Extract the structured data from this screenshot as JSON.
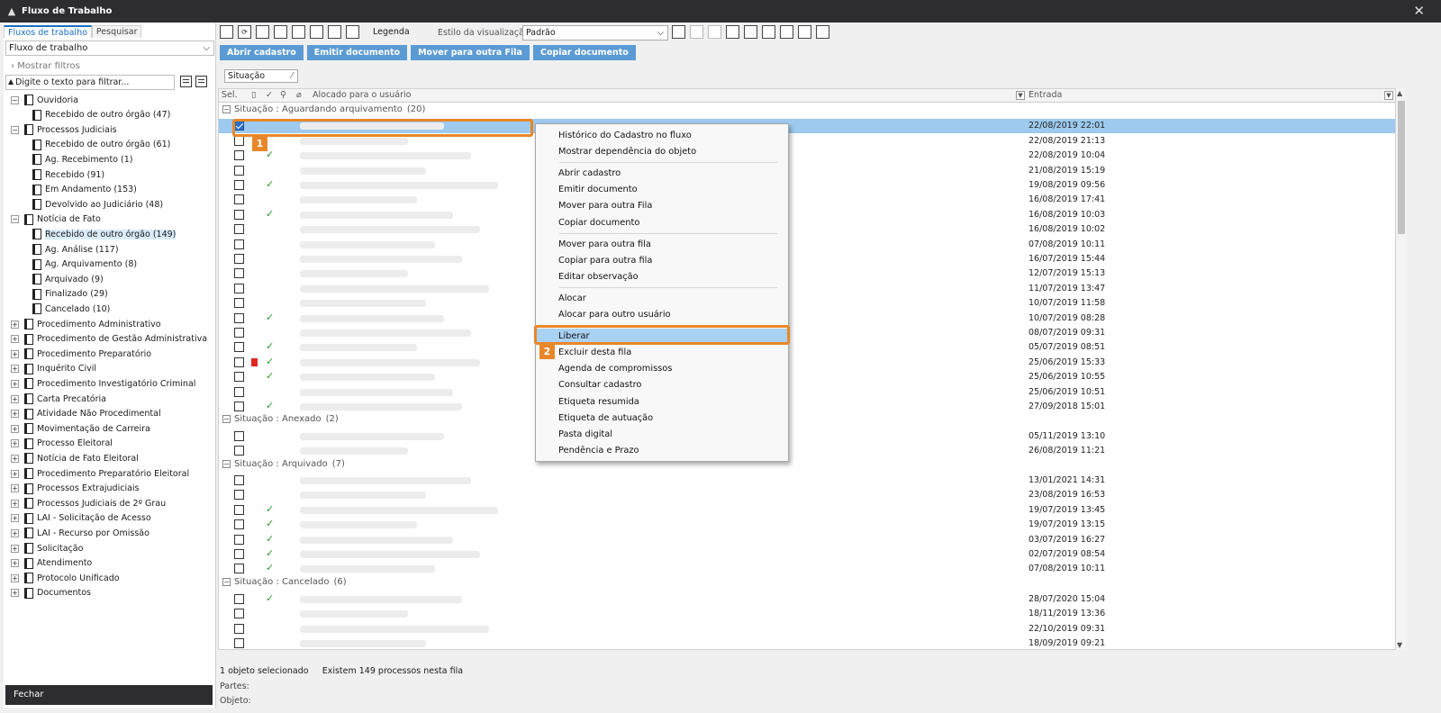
{
  "window": {
    "title": "Fluxo de Trabalho",
    "close": "✕"
  },
  "left": {
    "tabs": [
      "Fluxos de trabalho",
      "Pesquisar"
    ],
    "workflow_select": "Fluxo de trabalho",
    "show_filters": "Mostrar filtros",
    "filter_placeholder": "Digite o texto para filtrar...",
    "tree": [
      {
        "label": "Ouvidoria",
        "level": 0,
        "exp": "−"
      },
      {
        "label": "Recebido de outro órgão (47)",
        "level": 1
      },
      {
        "label": "Processos Judiciais",
        "level": 0,
        "exp": "−"
      },
      {
        "label": "Recebido de outro órgão (61)",
        "level": 1
      },
      {
        "label": "Ag. Recebimento (1)",
        "level": 1
      },
      {
        "label": "Recebido (91)",
        "level": 1
      },
      {
        "label": "Em Andamento (153)",
        "level": 1
      },
      {
        "label": "Devolvido ao Judiciário (48)",
        "level": 1
      },
      {
        "label": "Notícia de Fato",
        "level": 0,
        "exp": "−"
      },
      {
        "label": "Recebido de outro órgão (149)",
        "level": 1,
        "selected": true
      },
      {
        "label": "Ag. Análise (117)",
        "level": 1
      },
      {
        "label": "Ag. Arquivamento (8)",
        "level": 1
      },
      {
        "label": "Arquivado (9)",
        "level": 1
      },
      {
        "label": "Finalizado (29)",
        "level": 1
      },
      {
        "label": "Cancelado (10)",
        "level": 1
      },
      {
        "label": "Procedimento Administrativo",
        "level": 0,
        "exp": "+"
      },
      {
        "label": "Procedimento de Gestão Administrativa",
        "level": 0,
        "exp": "+"
      },
      {
        "label": "Procedimento Preparatório",
        "level": 0,
        "exp": "+"
      },
      {
        "label": "Inquérito Civil",
        "level": 0,
        "exp": "+"
      },
      {
        "label": "Procedimento Investigatório Criminal",
        "level": 0,
        "exp": "+"
      },
      {
        "label": "Carta Precatória",
        "level": 0,
        "exp": "+"
      },
      {
        "label": "Atividade Não Procedimental",
        "level": 0,
        "exp": "+"
      },
      {
        "label": "Movimentação de Carreira",
        "level": 0,
        "exp": "+"
      },
      {
        "label": "Processo Eleitoral",
        "level": 0,
        "exp": "+"
      },
      {
        "label": "Notícia de Fato Eleitoral",
        "level": 0,
        "exp": "+"
      },
      {
        "label": "Procedimento Preparatório Eleitoral",
        "level": 0,
        "exp": "+"
      },
      {
        "label": "Processos Extrajudiciais",
        "level": 0,
        "exp": "+"
      },
      {
        "label": "Processos Judiciais de 2º Grau",
        "level": 0,
        "exp": "+"
      },
      {
        "label": "LAI - Solicitação de Acesso",
        "level": 0,
        "exp": "+"
      },
      {
        "label": "LAI - Recurso por Omissão",
        "level": 0,
        "exp": "+"
      },
      {
        "label": "Solicitação",
        "level": 0,
        "exp": "+"
      },
      {
        "label": "Atendimento",
        "level": 0,
        "exp": "+"
      },
      {
        "label": "Protocolo Unificado",
        "level": 0,
        "exp": "+"
      },
      {
        "label": "Documentos",
        "level": 0,
        "exp": "+"
      }
    ],
    "fechar": "Fechar"
  },
  "toolbar": {
    "legenda": "Legenda",
    "estilo_label": "Estilo da visualização",
    "estilo_value": "Padrão"
  },
  "actions": [
    "Abrir cadastro",
    "Emitir documento",
    "Mover para outra Fila",
    "Copiar documento"
  ],
  "group_by": "Situação",
  "grid": {
    "headers": {
      "sel": "Sel.",
      "alocado": "Alocado para o usuário",
      "entrada": "Entrada"
    },
    "groups": [
      {
        "label": "Situação : Aguardando arquivamento",
        "count": "(20)",
        "rows": [
          {
            "date": "22/08/2019 22:01",
            "checked": true,
            "hl": true
          },
          {
            "date": "22/08/2019 21:13"
          },
          {
            "date": "22/08/2019 10:04",
            "ok": true
          },
          {
            "date": "21/08/2019 15:19"
          },
          {
            "date": "19/08/2019 09:56",
            "ok": true
          },
          {
            "date": "16/08/2019 17:41"
          },
          {
            "date": "16/08/2019 10:03",
            "ok": true
          },
          {
            "date": "16/08/2019 10:02"
          },
          {
            "date": "07/08/2019 10:11"
          },
          {
            "date": "16/07/2019 15:44"
          },
          {
            "date": "12/07/2019 15:13"
          },
          {
            "date": "11/07/2019 13:47"
          },
          {
            "date": "10/07/2019 11:58"
          },
          {
            "date": "10/07/2019 08:28",
            "ok": true
          },
          {
            "date": "08/07/2019 09:31"
          },
          {
            "date": "05/07/2019 08:51",
            "ok": true
          },
          {
            "date": "25/06/2019 15:33",
            "ok": true,
            "flag": true
          },
          {
            "date": "25/06/2019 10:55",
            "ok": true
          },
          {
            "date": "25/06/2019 10:51"
          },
          {
            "date": "27/09/2018 15:01",
            "ok": true
          }
        ]
      },
      {
        "label": "Situação : Anexado",
        "count": "(2)",
        "rows": [
          {
            "date": "05/11/2019 13:10"
          },
          {
            "date": "26/08/2019 11:21"
          }
        ]
      },
      {
        "label": "Situação : Arquivado",
        "count": "(7)",
        "rows": [
          {
            "date": "13/01/2021 14:31"
          },
          {
            "date": "23/08/2019 16:53"
          },
          {
            "date": "19/07/2019 13:45",
            "ok": true
          },
          {
            "date": "19/07/2019 13:15",
            "ok": true
          },
          {
            "date": "03/07/2019 16:27",
            "ok": true
          },
          {
            "date": "02/07/2019 08:54",
            "ok": true
          },
          {
            "date": "07/08/2019 10:11",
            "ok": true
          }
        ]
      },
      {
        "label": "Situação : Cancelado",
        "count": "(6)",
        "rows": [
          {
            "date": "28/07/2020 15:04",
            "ok": true
          },
          {
            "date": "18/11/2019 13:36"
          },
          {
            "date": "22/10/2019 09:31"
          },
          {
            "date": "18/09/2019 09:21"
          }
        ]
      }
    ]
  },
  "context_menu": [
    {
      "label": "Histórico do Cadastro no fluxo"
    },
    {
      "label": "Mostrar dependência do objeto"
    },
    {
      "sep": true
    },
    {
      "label": "Abrir cadastro"
    },
    {
      "label": "Emitir documento"
    },
    {
      "label": "Mover para outra Fila"
    },
    {
      "label": "Copiar documento"
    },
    {
      "sep": true
    },
    {
      "label": "Mover para outra fila"
    },
    {
      "label": "Copiar para outra fila"
    },
    {
      "label": "Editar observação"
    },
    {
      "sep": true
    },
    {
      "label": "Alocar"
    },
    {
      "label": "Alocar para outro usuário"
    },
    {
      "sep": true
    },
    {
      "label": "Liberar",
      "highlighted": true
    },
    {
      "label": "Excluir desta fila"
    },
    {
      "label": "Agenda de compromissos"
    },
    {
      "label": "Consultar cadastro"
    },
    {
      "label": "Etiqueta resumida"
    },
    {
      "label": "Etiqueta de autuação"
    },
    {
      "label": "Pasta digital"
    },
    {
      "label": "Pendência e Prazo"
    }
  ],
  "callouts": [
    "1",
    "2"
  ],
  "status": {
    "selected": "1 objeto selecionado",
    "total": "Existem 149 processos nesta fila"
  },
  "footer": {
    "partes": "Partes:",
    "objeto": "Objeto:"
  }
}
